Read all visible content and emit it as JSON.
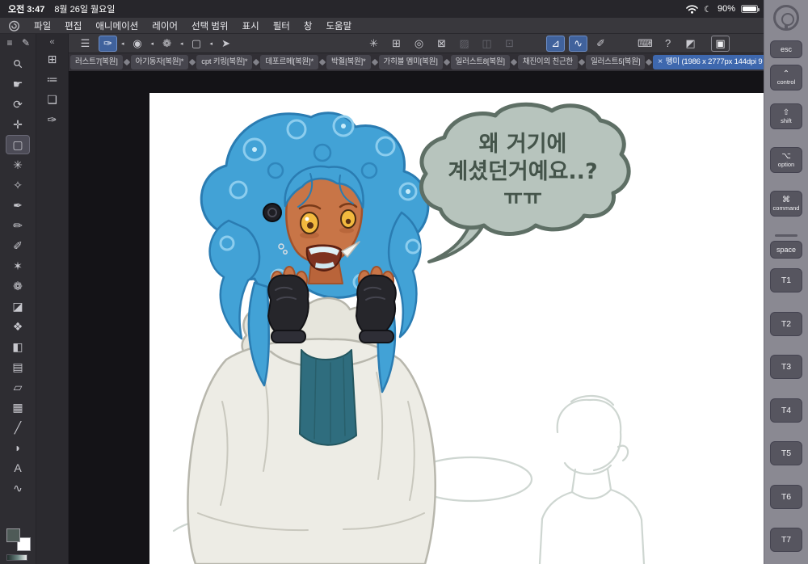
{
  "colors": {
    "accent_blue": "#3e68ae",
    "panel_dark": "#38373c",
    "edge_panel_gray": "#8a8992",
    "canvas_bg": "#ffffff",
    "hair_blue": "#42a2d6",
    "skin": "#c87547",
    "bubble_fill": "#b7c4bd",
    "primary_swatch": "#4e5a57",
    "secondary_swatch": "#ffffff"
  },
  "status_bar": {
    "time": "오전 3:47",
    "date": "8월 26일 월요일",
    "moon_glyph": "☾",
    "battery_percent": "90%"
  },
  "menu_bar": {
    "app_logo": "clip-studio-paint-logo",
    "items": [
      {
        "label": "파일"
      },
      {
        "label": "편집"
      },
      {
        "label": "애니메이션"
      },
      {
        "label": "레이어"
      },
      {
        "label": "선택 범위"
      },
      {
        "label": "표시"
      },
      {
        "label": "필터"
      },
      {
        "label": "창"
      },
      {
        "label": "도움말"
      }
    ]
  },
  "toolbar": {
    "icons": [
      {
        "name": "hamburger-menu",
        "glyph": "☰",
        "selected": false
      },
      {
        "name": "pen-subtool",
        "glyph": "✑",
        "selected": true
      },
      {
        "name": "airbrush-subtool",
        "glyph": "◉",
        "selected": false
      },
      {
        "name": "decoration-subtool",
        "glyph": "❁",
        "selected": false
      },
      {
        "name": "selection-subtool",
        "glyph": "▢",
        "selected": false
      },
      {
        "name": "object-subtool",
        "glyph": "➤",
        "selected": false
      },
      {
        "name": "spray-tool",
        "glyph": "✳",
        "selected": false
      },
      {
        "name": "mesh-transform",
        "glyph": "⊞",
        "selected": false
      },
      {
        "name": "loupe-tool",
        "glyph": "◎",
        "selected": false
      },
      {
        "name": "crop-frame",
        "glyph": "⊠",
        "selected": false
      },
      {
        "name": "mask-disabled",
        "glyph": "▨",
        "selected": false
      },
      {
        "name": "layer-disabled",
        "glyph": "◫",
        "selected": false
      },
      {
        "name": "duplicate-disabled",
        "glyph": "⊡",
        "selected": false
      },
      {
        "name": "polyline-correction",
        "glyph": "⊿",
        "selected": true
      },
      {
        "name": "curve-correction",
        "glyph": "∿",
        "selected": true
      },
      {
        "name": "slant-pencil",
        "glyph": "✐",
        "selected": false
      },
      {
        "name": "edge-keyboard-toggle",
        "glyph": "⌨",
        "selected": false
      },
      {
        "name": "shortcut-help",
        "glyph": "?",
        "selected": false
      },
      {
        "name": "screen-tone",
        "glyph": "◩",
        "selected": false
      },
      {
        "name": "fullscreen-toggle",
        "glyph": "▣",
        "selected": false
      }
    ]
  },
  "tab_bar": {
    "tabs": [
      {
        "label": "러스트7[복원]",
        "active": false
      },
      {
        "label": "아기동자[복원]*",
        "active": false
      },
      {
        "label": "cpt 키링[복원]*",
        "active": false
      },
      {
        "label": "데포르메[복원]*",
        "active": false
      },
      {
        "label": "박쥘[복원]*",
        "active": false
      },
      {
        "label": "가히블 멤미[복원]",
        "active": false
      },
      {
        "label": "일러스트8[복원]",
        "active": false
      },
      {
        "label": "채진이의 친근한",
        "active": false
      },
      {
        "label": "일러스트5[복원]",
        "active": false
      },
      {
        "label": "뗑미 (1986 x 2777px 144dpi 9",
        "active": true,
        "close_glyph": "×"
      }
    ]
  },
  "tool_palette": {
    "header": [
      {
        "name": "palette-menu",
        "glyph": "≡"
      },
      {
        "name": "tool-edit",
        "glyph": "✎"
      }
    ],
    "tools": [
      {
        "name": "zoom-tool",
        "glyph": "⚲",
        "selected": false
      },
      {
        "name": "hand-tool",
        "glyph": "☛",
        "selected": false
      },
      {
        "name": "rotate-canvas-tool",
        "glyph": "⟳",
        "selected": false
      },
      {
        "name": "move-tool",
        "glyph": "✛",
        "selected": false
      },
      {
        "name": "marquee-select-tool",
        "glyph": "▢",
        "selected": true
      },
      {
        "name": "auto-select-tool",
        "glyph": "✳",
        "selected": false
      },
      {
        "name": "eyedropper-tool",
        "glyph": "✧",
        "selected": false
      },
      {
        "name": "pen-tool",
        "glyph": "✒",
        "selected": false
      },
      {
        "name": "pencil-tool",
        "glyph": "✏",
        "selected": false
      },
      {
        "name": "brush-tool",
        "glyph": "✐",
        "selected": false
      },
      {
        "name": "airbrush-tool",
        "glyph": "✶",
        "selected": false
      },
      {
        "name": "decoration-tool",
        "glyph": "❁",
        "selected": false
      },
      {
        "name": "eraser-tool",
        "glyph": "◪",
        "selected": false
      },
      {
        "name": "blend-tool",
        "glyph": "❖",
        "selected": false
      },
      {
        "name": "fill-tool",
        "glyph": "◧",
        "selected": false
      },
      {
        "name": "gradient-tool",
        "glyph": "▤",
        "selected": false
      },
      {
        "name": "figure-tool",
        "glyph": "▱",
        "selected": false
      },
      {
        "name": "frame-border-tool",
        "glyph": "▦",
        "selected": false
      },
      {
        "name": "ruler-tool",
        "glyph": "╱",
        "selected": false
      },
      {
        "name": "balloon-tool",
        "glyph": "◗",
        "selected": false
      },
      {
        "name": "text-tool",
        "glyph": "A",
        "selected": false
      },
      {
        "name": "line-correction-tool",
        "glyph": "∿",
        "selected": false
      }
    ]
  },
  "panel_column": {
    "collapse_glyph": "«",
    "icons": [
      {
        "name": "quick-access-panel",
        "glyph": "⊞"
      },
      {
        "name": "subtool-detail-panel",
        "glyph": "≔"
      },
      {
        "name": "layer-panel",
        "glyph": "❏"
      },
      {
        "name": "brush-size-panel",
        "glyph": "✑"
      }
    ]
  },
  "canvas": {
    "speech_bubble": {
      "lines": [
        "왜 거기에",
        "계셨던거예요..?",
        "ㅠㅠ"
      ]
    }
  },
  "edge_keyboard": {
    "keys": [
      {
        "name": "esc",
        "symbol": "",
        "label": "esc"
      },
      {
        "name": "control",
        "symbol": "⌃",
        "label": "control"
      },
      {
        "name": "shift",
        "symbol": "⇧",
        "label": "shift"
      },
      {
        "name": "option",
        "symbol": "⌥",
        "label": "option"
      },
      {
        "name": "command",
        "symbol": "⌘",
        "label": "command"
      },
      {
        "name": "space",
        "symbol": "",
        "label": "space"
      },
      {
        "name": "t1",
        "label": "T1"
      },
      {
        "name": "t2",
        "label": "T2"
      },
      {
        "name": "t3",
        "label": "T3"
      },
      {
        "name": "t4",
        "label": "T4"
      },
      {
        "name": "t5",
        "label": "T5"
      },
      {
        "name": "t6",
        "label": "T6"
      },
      {
        "name": "t7",
        "label": "T7"
      }
    ]
  }
}
